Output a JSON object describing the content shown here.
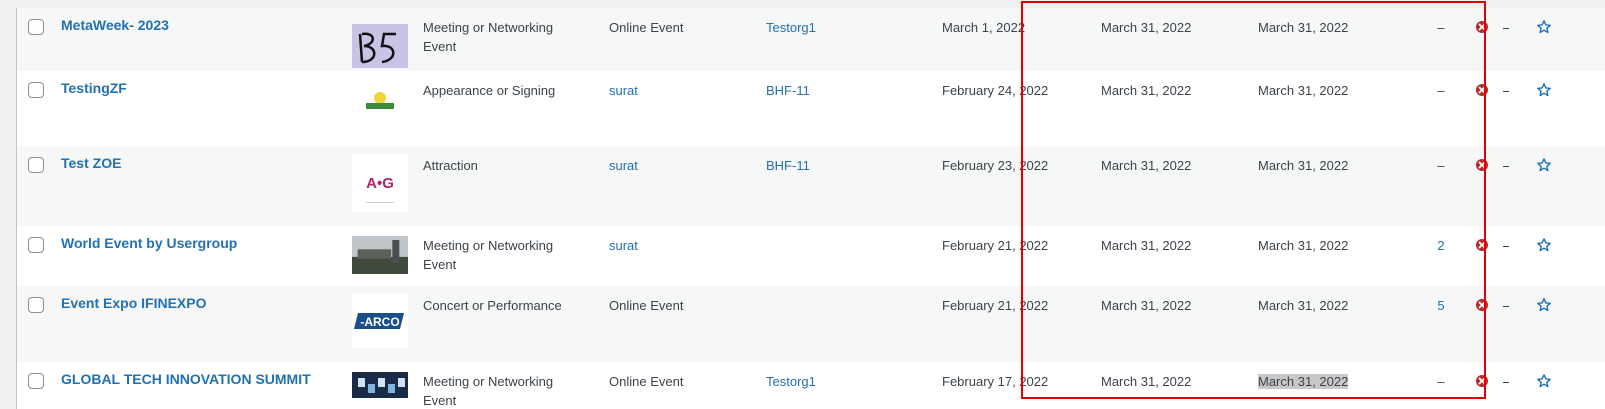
{
  "events": [
    {
      "title": "MetaWeek- 2023",
      "category": "Meeting or Networking Event",
      "location": "Online Event",
      "location_is_link": false,
      "organizer": "Testorg1",
      "date_created": "March 1, 2022",
      "date_start": "March 31, 2022",
      "date_end": "March 31, 2022",
      "count": "–",
      "count_is_link": false,
      "thumb": "handwritten"
    },
    {
      "title": "TestingZF",
      "category": "Appearance or Signing",
      "location": "surat",
      "location_is_link": true,
      "organizer": "BHF-11",
      "date_created": "February 24, 2022",
      "date_start": "March 31, 2022",
      "date_end": "March 31, 2022",
      "count": "–",
      "count_is_link": false,
      "thumb": "small-logo"
    },
    {
      "title": "Test ZOE",
      "category": "Attraction",
      "location": "surat",
      "location_is_link": true,
      "organizer": "BHF-11",
      "date_created": "February 23, 2022",
      "date_start": "March 31, 2022",
      "date_end": "March 31, 2022",
      "count": "–",
      "count_is_link": false,
      "thumb": "ag-logo",
      "thumb_text": "A•G"
    },
    {
      "title": "World Event by Usergroup",
      "category": "Meeting or Networking Event",
      "location": "surat",
      "location_is_link": true,
      "organizer": "",
      "date_created": "February 21, 2022",
      "date_start": "March 31, 2022",
      "date_end": "March 31, 2022",
      "count": "2",
      "count_is_link": true,
      "thumb": "city-photo"
    },
    {
      "title": "Event Expo IFINEXPO",
      "category": "Concert or Performance",
      "location": "Online Event",
      "location_is_link": false,
      "organizer": "",
      "date_created": "February 21, 2022",
      "date_start": "March 31, 2022",
      "date_end": "March 31, 2022",
      "count": "5",
      "count_is_link": true,
      "thumb": "arco-logo",
      "thumb_text": "-ARCO"
    },
    {
      "title": "GLOBAL TECH INNOVATION SUMMIT",
      "category": "Meeting or Networking Event",
      "location": "Online Event",
      "location_is_link": false,
      "organizer": "Testorg1",
      "date_created": "February 17, 2022",
      "date_start": "March 31, 2022",
      "date_end": "March 31, 2022",
      "count": "–",
      "count_is_link": false,
      "thumb": "tech-photo",
      "end_selected": true
    }
  ],
  "colors": {
    "link": "#2271b1",
    "delete_icon": "#b32d2e",
    "highlight": "#e00000",
    "text": "#3c434a"
  },
  "icons": {
    "delete": "x-circle-icon",
    "favorite": "star-outline-icon"
  }
}
